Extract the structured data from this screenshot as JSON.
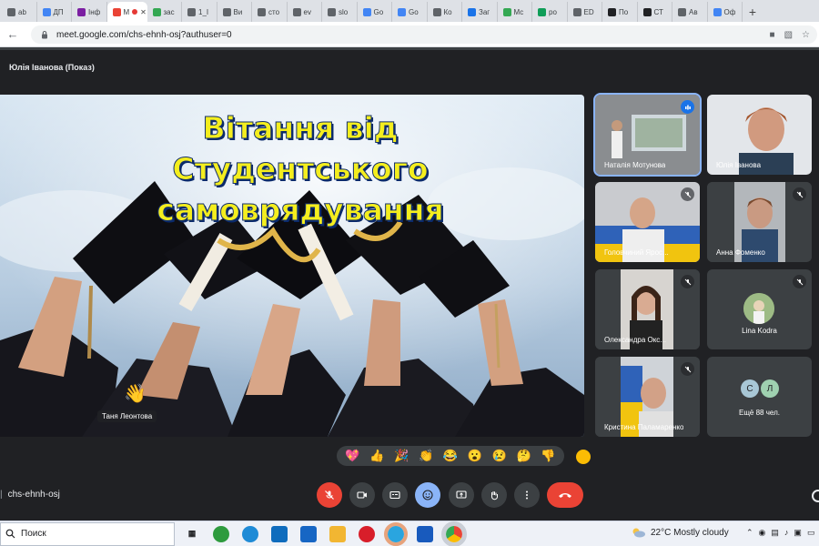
{
  "browser": {
    "tabs": [
      {
        "label": "ab",
        "color": "#5f6368"
      },
      {
        "label": "ДП",
        "color": "#4285f4"
      },
      {
        "label": "Інф",
        "color": "#7b1fa2"
      },
      {
        "label": "М",
        "color": "#ea4335",
        "active": true
      },
      {
        "label": "зас",
        "color": "#34a853"
      },
      {
        "label": "1_І",
        "color": "#5f6368"
      },
      {
        "label": "Ви",
        "color": "#5f6368"
      },
      {
        "label": "сто",
        "color": "#5f6368"
      },
      {
        "label": "ev",
        "color": "#5f6368"
      },
      {
        "label": "slo",
        "color": "#5f6368"
      },
      {
        "label": "Go",
        "color": "#4285f4"
      },
      {
        "label": "Go",
        "color": "#4285f4"
      },
      {
        "label": "Ко",
        "color": "#5f6368"
      },
      {
        "label": "Заг",
        "color": "#1a73e8"
      },
      {
        "label": "Мс",
        "color": "#34a853"
      },
      {
        "label": "ро",
        "color": "#0f9d58"
      },
      {
        "label": "ED",
        "color": "#5f6368"
      },
      {
        "label": "По",
        "color": "#202124"
      },
      {
        "label": "СТ",
        "color": "#202124"
      },
      {
        "label": "Ав",
        "color": "#5f6368"
      },
      {
        "label": "Оф",
        "color": "#4285f4"
      }
    ],
    "url": "meet.google.com/chs-ehnh-osj?authuser=0"
  },
  "meeting": {
    "presenter_label": "Юлія Іванова (Показ)",
    "slide": {
      "title_line1": "Вітання від",
      "title_line2": "Студентського",
      "title_line3": "самоврядування",
      "raised_hand_name": "Таня Леонтова"
    },
    "participants": [
      {
        "name": "Наталія Мотунова",
        "muted": false,
        "speaking": true
      },
      {
        "name": "Юлія Іванова",
        "muted": false
      },
      {
        "name": "Головчиний Ярос...",
        "muted": true
      },
      {
        "name": "Анна Фоменко",
        "muted": true
      },
      {
        "name": "Олександра Окс...",
        "muted": true
      },
      {
        "name": "Lina Kodra",
        "muted": true
      },
      {
        "name": "Кристина Паламаренко",
        "muted": true
      }
    ],
    "others": {
      "avatars": [
        "С",
        "Л"
      ],
      "label": "Ещё 88 чел."
    },
    "reactions": [
      "💖",
      "👍",
      "🎉",
      "👏",
      "😂",
      "😮",
      "😢",
      "🤔",
      "👎"
    ],
    "meeting_code": "chs-ehnh-osj",
    "colors": {
      "end_call": "#ea4335",
      "accent": "#8ab4f8",
      "tile_bg": "#3c4043",
      "bg": "#202124"
    }
  },
  "taskbar": {
    "search_label": "Поиск",
    "weather": "22°C  Mostly cloudy"
  }
}
